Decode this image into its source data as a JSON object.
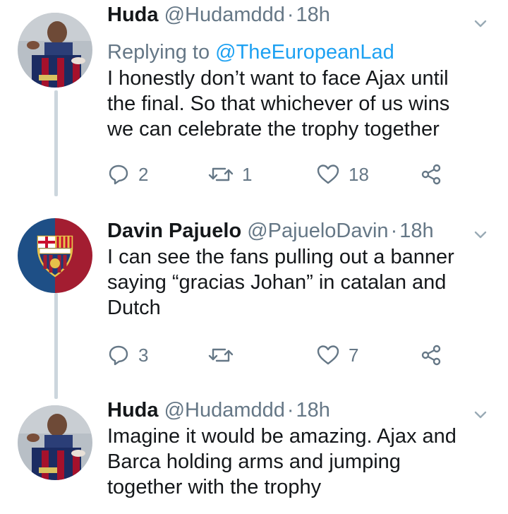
{
  "tweets": [
    {
      "name": "Huda",
      "handle": "@Hudamddd",
      "sep": "·",
      "time": "18h",
      "reply_prefix": "Replying to",
      "reply_handle": "@TheEuropeanLad",
      "lines": [
        "I honestly don’t want to face Ajax until",
        "the final. So that whichever of us wins",
        "we can celebrate the trophy together"
      ],
      "replies": "2",
      "retweets": "1",
      "likes": "18",
      "avatar_icon": "player-photo-avatar"
    },
    {
      "name": "Davin Pajuelo",
      "handle": "@PajueloDavin",
      "sep": "·",
      "time": "18h",
      "lines": [
        "I can see the fans pulling out a banner",
        "saying “gracias Johan” in catalan and",
        "Dutch"
      ],
      "replies": "3",
      "retweets": "",
      "likes": "7",
      "avatar_icon": "fcb-crest-avatar"
    },
    {
      "name": "Huda",
      "handle": "@Hudamddd",
      "sep": "·",
      "time": "18h",
      "lines": [
        "Imagine it would be amazing. Ajax and",
        "Barca holding arms and jumping",
        "together with the trophy"
      ],
      "avatar_icon": "player-photo-avatar"
    }
  ],
  "colors": {
    "text": "#14171a",
    "muted": "#657786",
    "link": "#1da1f2",
    "thread_line": "#ccd6dd"
  }
}
